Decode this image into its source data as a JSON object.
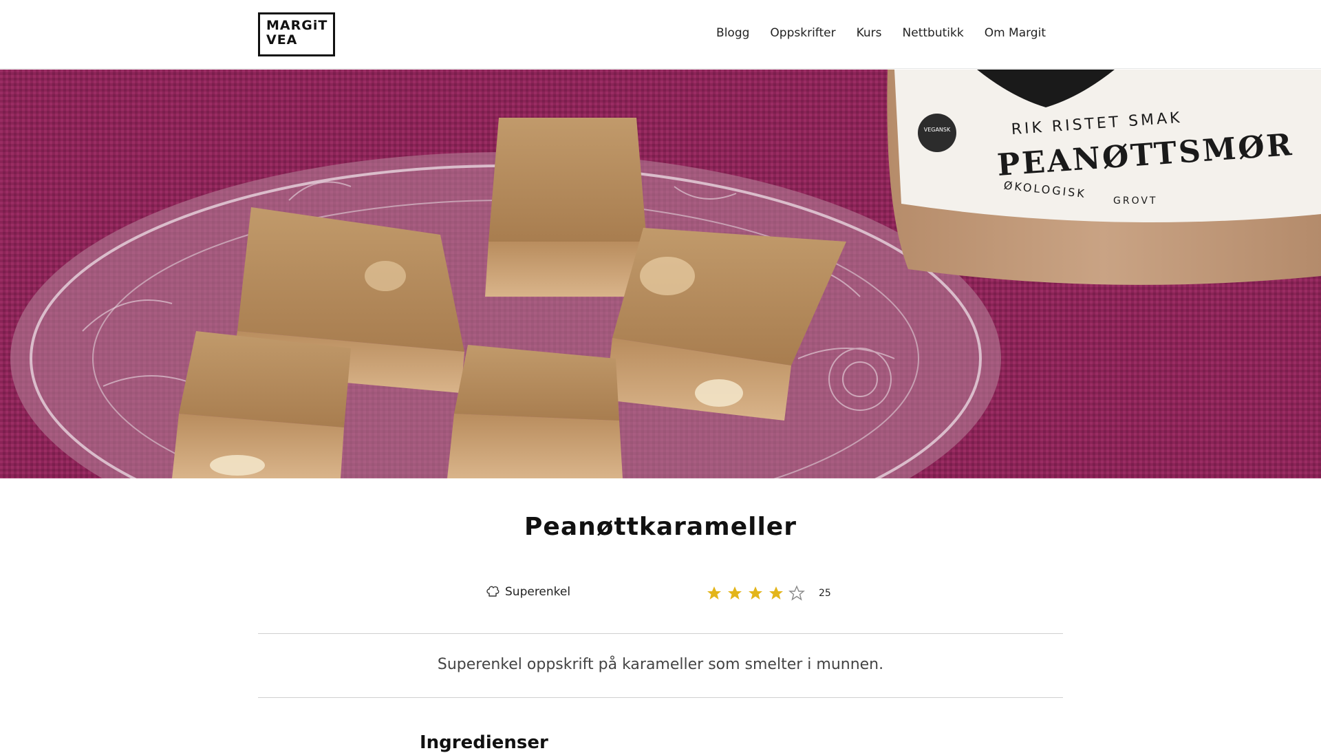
{
  "logo": {
    "line1": "MARGiT",
    "line2": "VEA"
  },
  "nav": {
    "items": [
      "Blogg",
      "Oppskrifter",
      "Kurs",
      "Nettbutikk",
      "Om Margit"
    ]
  },
  "hero": {
    "jar_label": {
      "tagline": "RIK RISTET SMAK",
      "product": "PEANØTTSMØR",
      "badge": "VEGANSK",
      "type1": "ØKOLOGISK",
      "type2": "GROVT"
    }
  },
  "recipe": {
    "title": "Peanøttkarameller",
    "difficulty": "Superenkel",
    "rating": {
      "value": 4,
      "max": 5,
      "count": "25"
    },
    "intro": "Superenkel oppskrift på karameller som smelter i munnen.",
    "ingredients_heading": "Ingredienser"
  },
  "colors": {
    "star_filled": "#e3b51a",
    "star_empty": "#888888",
    "background_fabric": "#8a2456"
  }
}
